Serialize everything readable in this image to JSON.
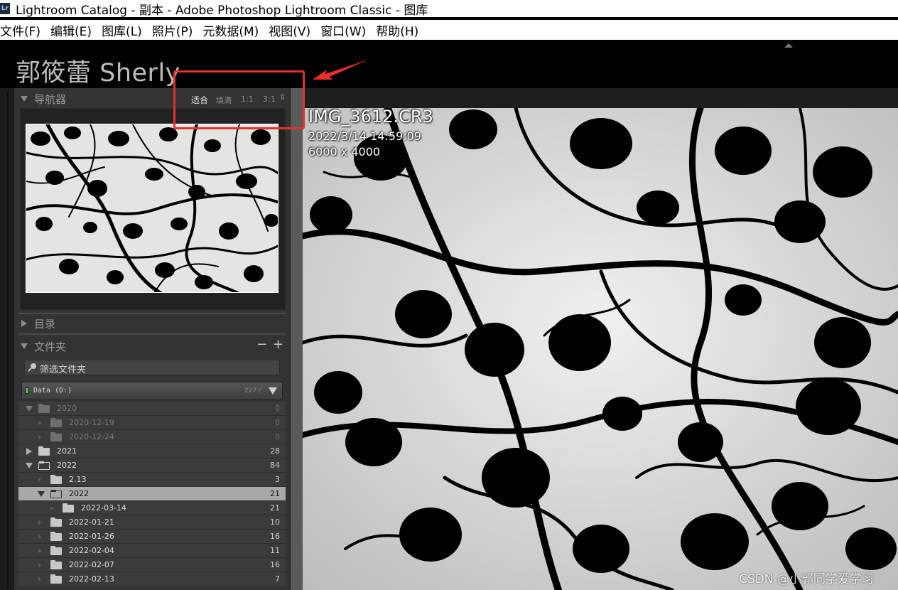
{
  "window": {
    "app_icon": "Lr",
    "title": "Lightroom Catalog - 副本 - Adobe Photoshop Lightroom Classic - 图库"
  },
  "menu": [
    "文件(F)",
    "编辑(E)",
    "图库(L)",
    "照片(P)",
    "元数据(M)",
    "视图(V)",
    "窗口(W)",
    "帮助(H)"
  ],
  "identity_plate": "郭筱蕾 Sherly",
  "navigator": {
    "label": "导航器",
    "zoom_options": [
      "适合",
      "填满",
      "1:1",
      "3:1"
    ],
    "active_zoom": "适合"
  },
  "catalog": {
    "label": "目录"
  },
  "folders": {
    "label": "文件夹",
    "minus": "−",
    "plus": "+",
    "filter_placeholder": "筛选文件夹",
    "volume": {
      "name": "Data (D:)",
      "count": "227 /"
    },
    "rows": [
      {
        "name": "2020",
        "count": "0"
      },
      {
        "name": "2020-12-19",
        "count": "0"
      },
      {
        "name": "2020-12-24",
        "count": "0"
      },
      {
        "name": "2021",
        "count": "28"
      },
      {
        "name": "2022",
        "count": "84"
      },
      {
        "name": "2.13",
        "count": "3"
      },
      {
        "name": "2022",
        "count": "21"
      },
      {
        "name": "2022-03-14",
        "count": "21"
      },
      {
        "name": "2022-01-21",
        "count": "10"
      },
      {
        "name": "2022-01-26",
        "count": "16"
      },
      {
        "name": "2022-02-04",
        "count": "11"
      },
      {
        "name": "2022-02-07",
        "count": "16"
      },
      {
        "name": "2022-02-13",
        "count": "7"
      }
    ]
  },
  "photo_info": {
    "filename": "IMG_3612.CR3",
    "datetime": "2022/3/14 14:59:09",
    "dimensions": "6000 x 4000"
  },
  "watermark": "CSDN @小郭同学爱学习",
  "colors": {
    "annotation": "#e8302a",
    "panel_bg": "#333333",
    "selected_row": "#a9a9a9"
  }
}
